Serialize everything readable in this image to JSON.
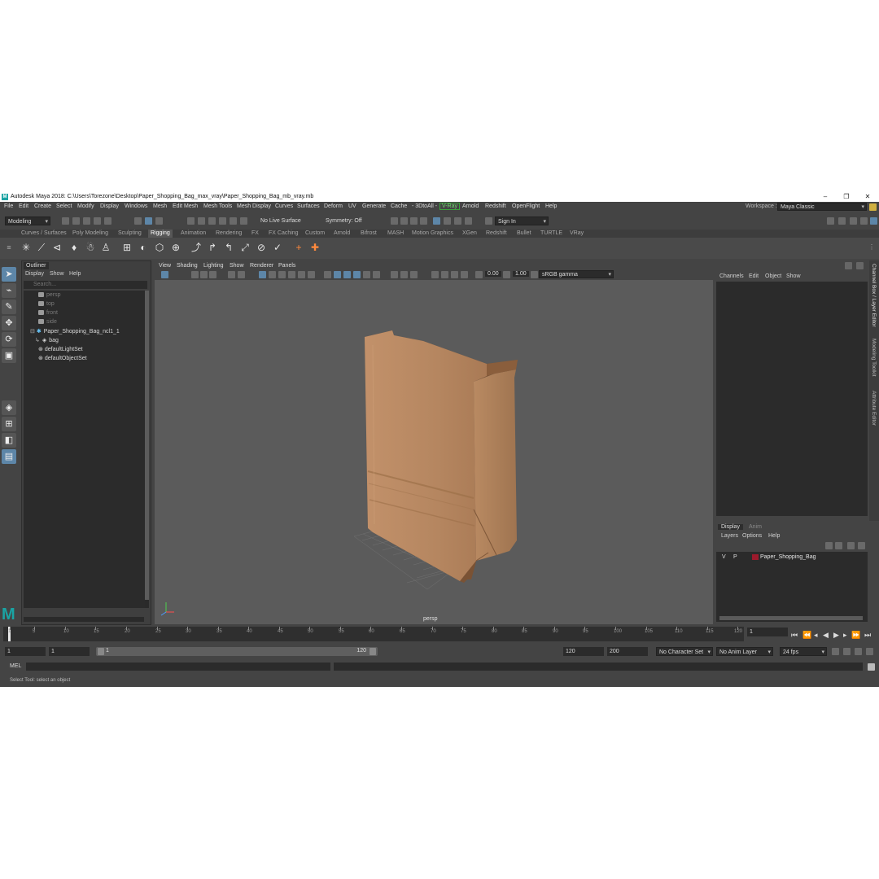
{
  "window": {
    "title": "Autodesk Maya 2018: C:\\Users\\Torezone\\Desktop\\Paper_Shopping_Bag_max_vray\\Paper_Shopping_Bag_mb_vray.mb",
    "min": "–",
    "max": "❐",
    "close": "✕"
  },
  "menubar": [
    "File",
    "Edit",
    "Create",
    "Select",
    "Modify",
    "Display",
    "Windows",
    "Mesh",
    "Edit Mesh",
    "Mesh Tools",
    "Mesh Display",
    "Curves",
    "Surfaces",
    "Deform",
    "UV",
    "Generate",
    "Cache",
    "- 3DtoAll -",
    "V-Ray",
    "Arnold",
    "Redshift",
    "OpenFlight",
    "Help"
  ],
  "workspace": {
    "label": "Workspace :",
    "value": "Maya Classic"
  },
  "toolbar": {
    "mode": "Modeling",
    "live_surface": "No Live Surface",
    "symmetry": "Symmetry: Off",
    "sign_in": "Sign In"
  },
  "shelf_tabs": [
    "Curves / Surfaces",
    "Poly Modeling",
    "Sculpting",
    "Rigging",
    "Animation",
    "Rendering",
    "FX",
    "FX Caching",
    "Custom",
    "Arnold",
    "Bifrost",
    "MASH",
    "Motion Graphics",
    "XGen",
    "Redshift",
    "Bullet",
    "TURTLE",
    "VRay"
  ],
  "active_shelf_tab": "Rigging",
  "outliner": {
    "title": "Outliner",
    "menu": [
      "Display",
      "Show",
      "Help"
    ],
    "search_placeholder": "Search...",
    "items": [
      {
        "label": "persp",
        "dim": true
      },
      {
        "label": "top",
        "dim": true
      },
      {
        "label": "front",
        "dim": true
      },
      {
        "label": "side",
        "dim": true
      },
      {
        "label": "Paper_Shopping_Bag_ncl1_1",
        "dim": false
      },
      {
        "label": "bag",
        "dim": false
      },
      {
        "label": "defaultLightSet",
        "dim": false
      },
      {
        "label": "defaultObjectSet",
        "dim": false
      }
    ]
  },
  "viewport": {
    "menu": [
      "View",
      "Shading",
      "Lighting",
      "Show",
      "Renderer",
      "Panels"
    ],
    "exposure": "0.00",
    "gamma": "1.00",
    "color_space": "sRGB gamma",
    "camera_label": "persp"
  },
  "channel_box": {
    "menu": [
      "Channels",
      "Edit",
      "Object",
      "Show"
    ],
    "side_tabs": [
      "Channel Box / Layer Editor",
      "Modeling Toolkit",
      "Attribute Editor"
    ]
  },
  "layer_editor": {
    "tabs": [
      "Display",
      "Anim"
    ],
    "menu": [
      "Layers",
      "Options",
      "Help"
    ],
    "layer": {
      "v": "V",
      "p": "P",
      "name": "Paper_Shopping_Bag",
      "color": "#9c1a2c"
    }
  },
  "timeline": {
    "ticks": [
      "1",
      "5",
      "10",
      "15",
      "20",
      "25",
      "30",
      "35",
      "40",
      "45",
      "50",
      "55",
      "60",
      "65",
      "70",
      "75",
      "80",
      "85",
      "90",
      "95",
      "100",
      "105",
      "110",
      "115",
      "120"
    ],
    "current_frame": "1"
  },
  "range": {
    "start": "1",
    "inner_start": "1",
    "slider_start": "1",
    "slider_end": "120",
    "end": "120",
    "max_end": "200",
    "character_set": "No Character Set",
    "anim_layer": "No Anim Layer",
    "fps": "24 fps"
  },
  "command": {
    "label": "MEL"
  },
  "status": {
    "text": "Select Tool: select an object"
  },
  "colors": {
    "accent": "#5d86a8",
    "bag": "#b8875f",
    "viewport_bg": "#5b5b5b"
  }
}
